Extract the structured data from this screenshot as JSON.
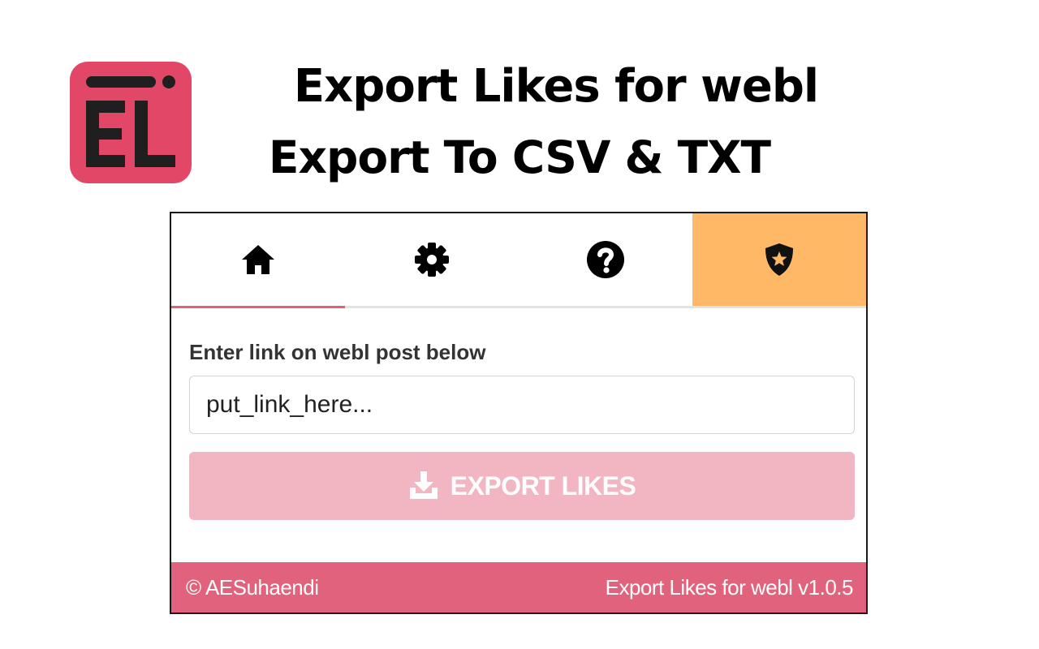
{
  "banner": {
    "logo_text": "EL",
    "title": "Export Likes for webl",
    "subtitle": "Export To CSV & TXT"
  },
  "tabs": [
    {
      "icon": "home-icon",
      "active": true
    },
    {
      "icon": "gear-icon",
      "active": false
    },
    {
      "icon": "help-icon",
      "active": false
    },
    {
      "icon": "shield-star-icon",
      "active": false,
      "highlight": true
    }
  ],
  "form": {
    "label": "Enter link on webl post below",
    "placeholder": "put_link_here...",
    "value": "",
    "export_label": "EXPORT LIKES"
  },
  "footer": {
    "copyright": "© AESuhaendi",
    "version": "Export Likes for webl v1.0.5"
  },
  "colors": {
    "brand": "#e24767",
    "tab_active_underline": "#e45f78",
    "premium_tab": "#ffb866",
    "export_button": "#f2b5c2",
    "footer": "#e1627c"
  }
}
